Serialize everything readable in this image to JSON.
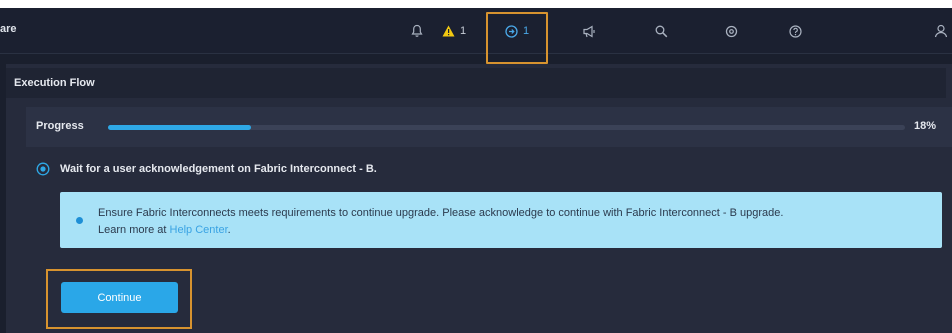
{
  "topbar": {
    "brand_fragment": "are",
    "warning_count": "1",
    "requests_count": "1",
    "icons": [
      "bell-icon",
      "warning-icon",
      "requests-icon",
      "megaphone-icon",
      "search-icon",
      "settings-icon",
      "help-icon",
      "user-icon"
    ]
  },
  "panel": {
    "title": "Execution Flow",
    "progress": {
      "label": "Progress",
      "percent_text": "18%",
      "value": 0.18
    },
    "step": {
      "text": "Wait for a user acknowledgement on Fabric Interconnect - B."
    },
    "info": {
      "message": "Ensure Fabric Interconnects meets requirements to continue upgrade. Please acknowledge to continue with Fabric Interconnect - B upgrade.",
      "learn_more_prefix": "Learn more at ",
      "link_text": "Help Center",
      "link_suffix": "."
    },
    "continue_label": "Continue"
  },
  "colors": {
    "accent": "#2aa7e8",
    "highlight": "#d7932f",
    "warning": "#f2c811",
    "info_bg": "#a8e2f7"
  }
}
